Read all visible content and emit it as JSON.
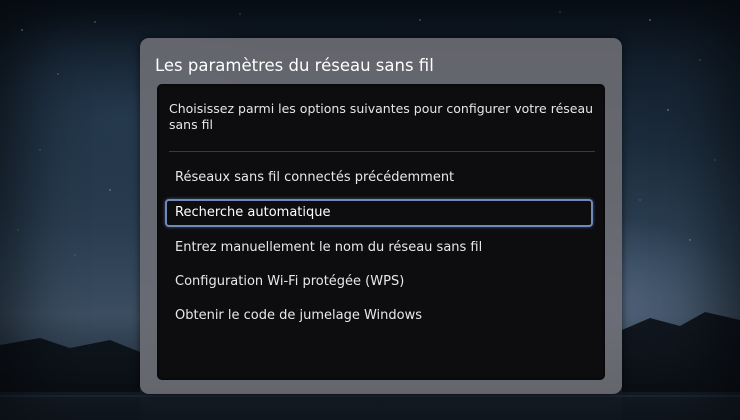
{
  "dialog": {
    "title": "Les paramètres du réseau sans fil",
    "description": "Choisissez parmi les options suivantes pour configurer votre réseau sans fil",
    "options": [
      {
        "label": "Réseaux sans fil connectés précédemment",
        "selected": false
      },
      {
        "label": "Recherche automatique",
        "selected": true
      },
      {
        "label": "Entrez manuellement le nom du réseau sans fil",
        "selected": false
      },
      {
        "label": "Configuration Wi-Fi protégée (WPS)",
        "selected": false
      },
      {
        "label": "Obtenir le code de jumelage Windows",
        "selected": false
      }
    ]
  },
  "colors": {
    "dialog_frame": "#707076",
    "panel": "#0d0d0f",
    "selection_border": "#6f8ab8",
    "text": "#e8e8e8"
  }
}
